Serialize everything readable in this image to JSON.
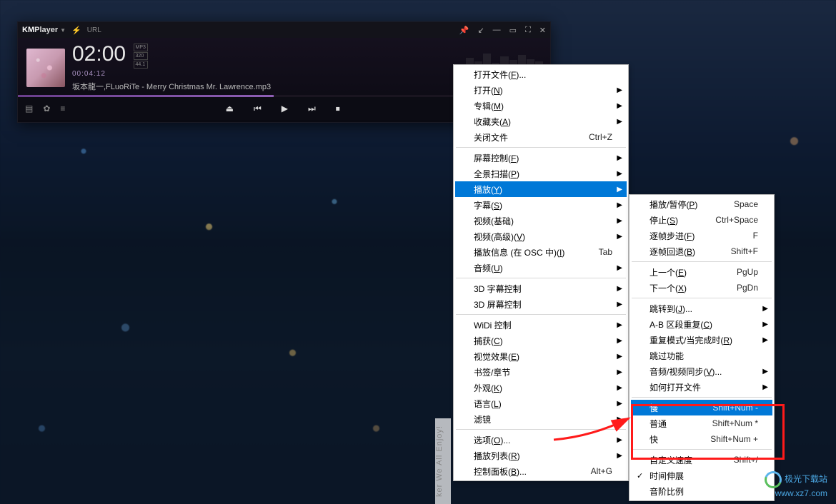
{
  "player": {
    "brand_prefix": "KM",
    "brand_suffix": "Player",
    "url_label": "URL",
    "big_time": "02:00",
    "badges": [
      "MP3",
      "320",
      "44.1"
    ],
    "duration": "00:04:12",
    "track": "坂本龍一,FLuoRiTe - Merry Christmas Mr. Lawrence.mp3"
  },
  "menu_main": [
    {
      "label": "打开文件(F)...",
      "arrow": false
    },
    {
      "label": "打开(N)",
      "arrow": true
    },
    {
      "label": "专辑(M)",
      "arrow": true
    },
    {
      "label": "收藏夹(A)",
      "arrow": true
    },
    {
      "label": "关闭文件",
      "shortcut": "Ctrl+Z"
    },
    {
      "sep": true
    },
    {
      "label": "屏幕控制(F)",
      "arrow": true
    },
    {
      "label": "全景扫描(P)",
      "arrow": true
    },
    {
      "label": "播放(Y)",
      "arrow": true,
      "hl": true
    },
    {
      "label": "字幕(S)",
      "arrow": true
    },
    {
      "label": "视频(基础)",
      "arrow": true
    },
    {
      "label": "视频(高级)(V)",
      "arrow": true
    },
    {
      "label": "播放信息 (在 OSC 中)(I)",
      "shortcut": "Tab"
    },
    {
      "label": "音频(U)",
      "arrow": true
    },
    {
      "sep": true
    },
    {
      "label": "3D 字幕控制",
      "arrow": true
    },
    {
      "label": "3D 屏幕控制",
      "arrow": true
    },
    {
      "sep": true
    },
    {
      "label": "WiDi 控制",
      "arrow": true
    },
    {
      "label": "捕获(C)",
      "arrow": true
    },
    {
      "label": "视觉效果(E)",
      "arrow": true
    },
    {
      "label": "书签/章节",
      "arrow": true
    },
    {
      "label": "外观(K)",
      "arrow": true
    },
    {
      "label": "语言(L)",
      "arrow": true
    },
    {
      "label": "滤镜",
      "arrow": true
    },
    {
      "sep": true
    },
    {
      "label": "选项(O)...",
      "arrow": true
    },
    {
      "label": "播放列表(R)",
      "arrow": true
    },
    {
      "label": "控制面板(B)...",
      "shortcut": "Alt+G"
    }
  ],
  "menu_play": [
    {
      "label": "播放/暂停(P)",
      "shortcut": "Space"
    },
    {
      "label": "停止(S)",
      "shortcut": "Ctrl+Space"
    },
    {
      "label": "逐帧步进(F)",
      "shortcut": "F"
    },
    {
      "label": "逐帧回退(B)",
      "shortcut": "Shift+F"
    },
    {
      "sep": true
    },
    {
      "label": "上一个(E)",
      "shortcut": "PgUp"
    },
    {
      "label": "下一个(X)",
      "shortcut": "PgDn"
    },
    {
      "sep": true
    },
    {
      "label": "跳转到(J)...",
      "arrow": true
    },
    {
      "label": "A-B 区段重复(C)",
      "arrow": true
    },
    {
      "label": "重复模式/当完成时(R)",
      "arrow": true
    },
    {
      "label": "跳过功能"
    },
    {
      "label": "音频/视频同步(V)...",
      "arrow": true
    },
    {
      "label": "如何打开文件",
      "arrow": true
    },
    {
      "sep": true
    },
    {
      "label": "慢",
      "shortcut": "Shift+Num -",
      "hl": true
    },
    {
      "label": "普通",
      "shortcut": "Shift+Num *"
    },
    {
      "label": "快",
      "shortcut": "Shift+Num +"
    },
    {
      "sep": true
    },
    {
      "label": "自定义速度",
      "shortcut": "Shift+/"
    },
    {
      "label": "时间伸展",
      "checked": true
    },
    {
      "label": "音阶比例"
    }
  ],
  "watermark": {
    "side": "ker  We All Enjoy!",
    "site_cn": "极光下载站",
    "site_url": "www.xz7.com"
  }
}
